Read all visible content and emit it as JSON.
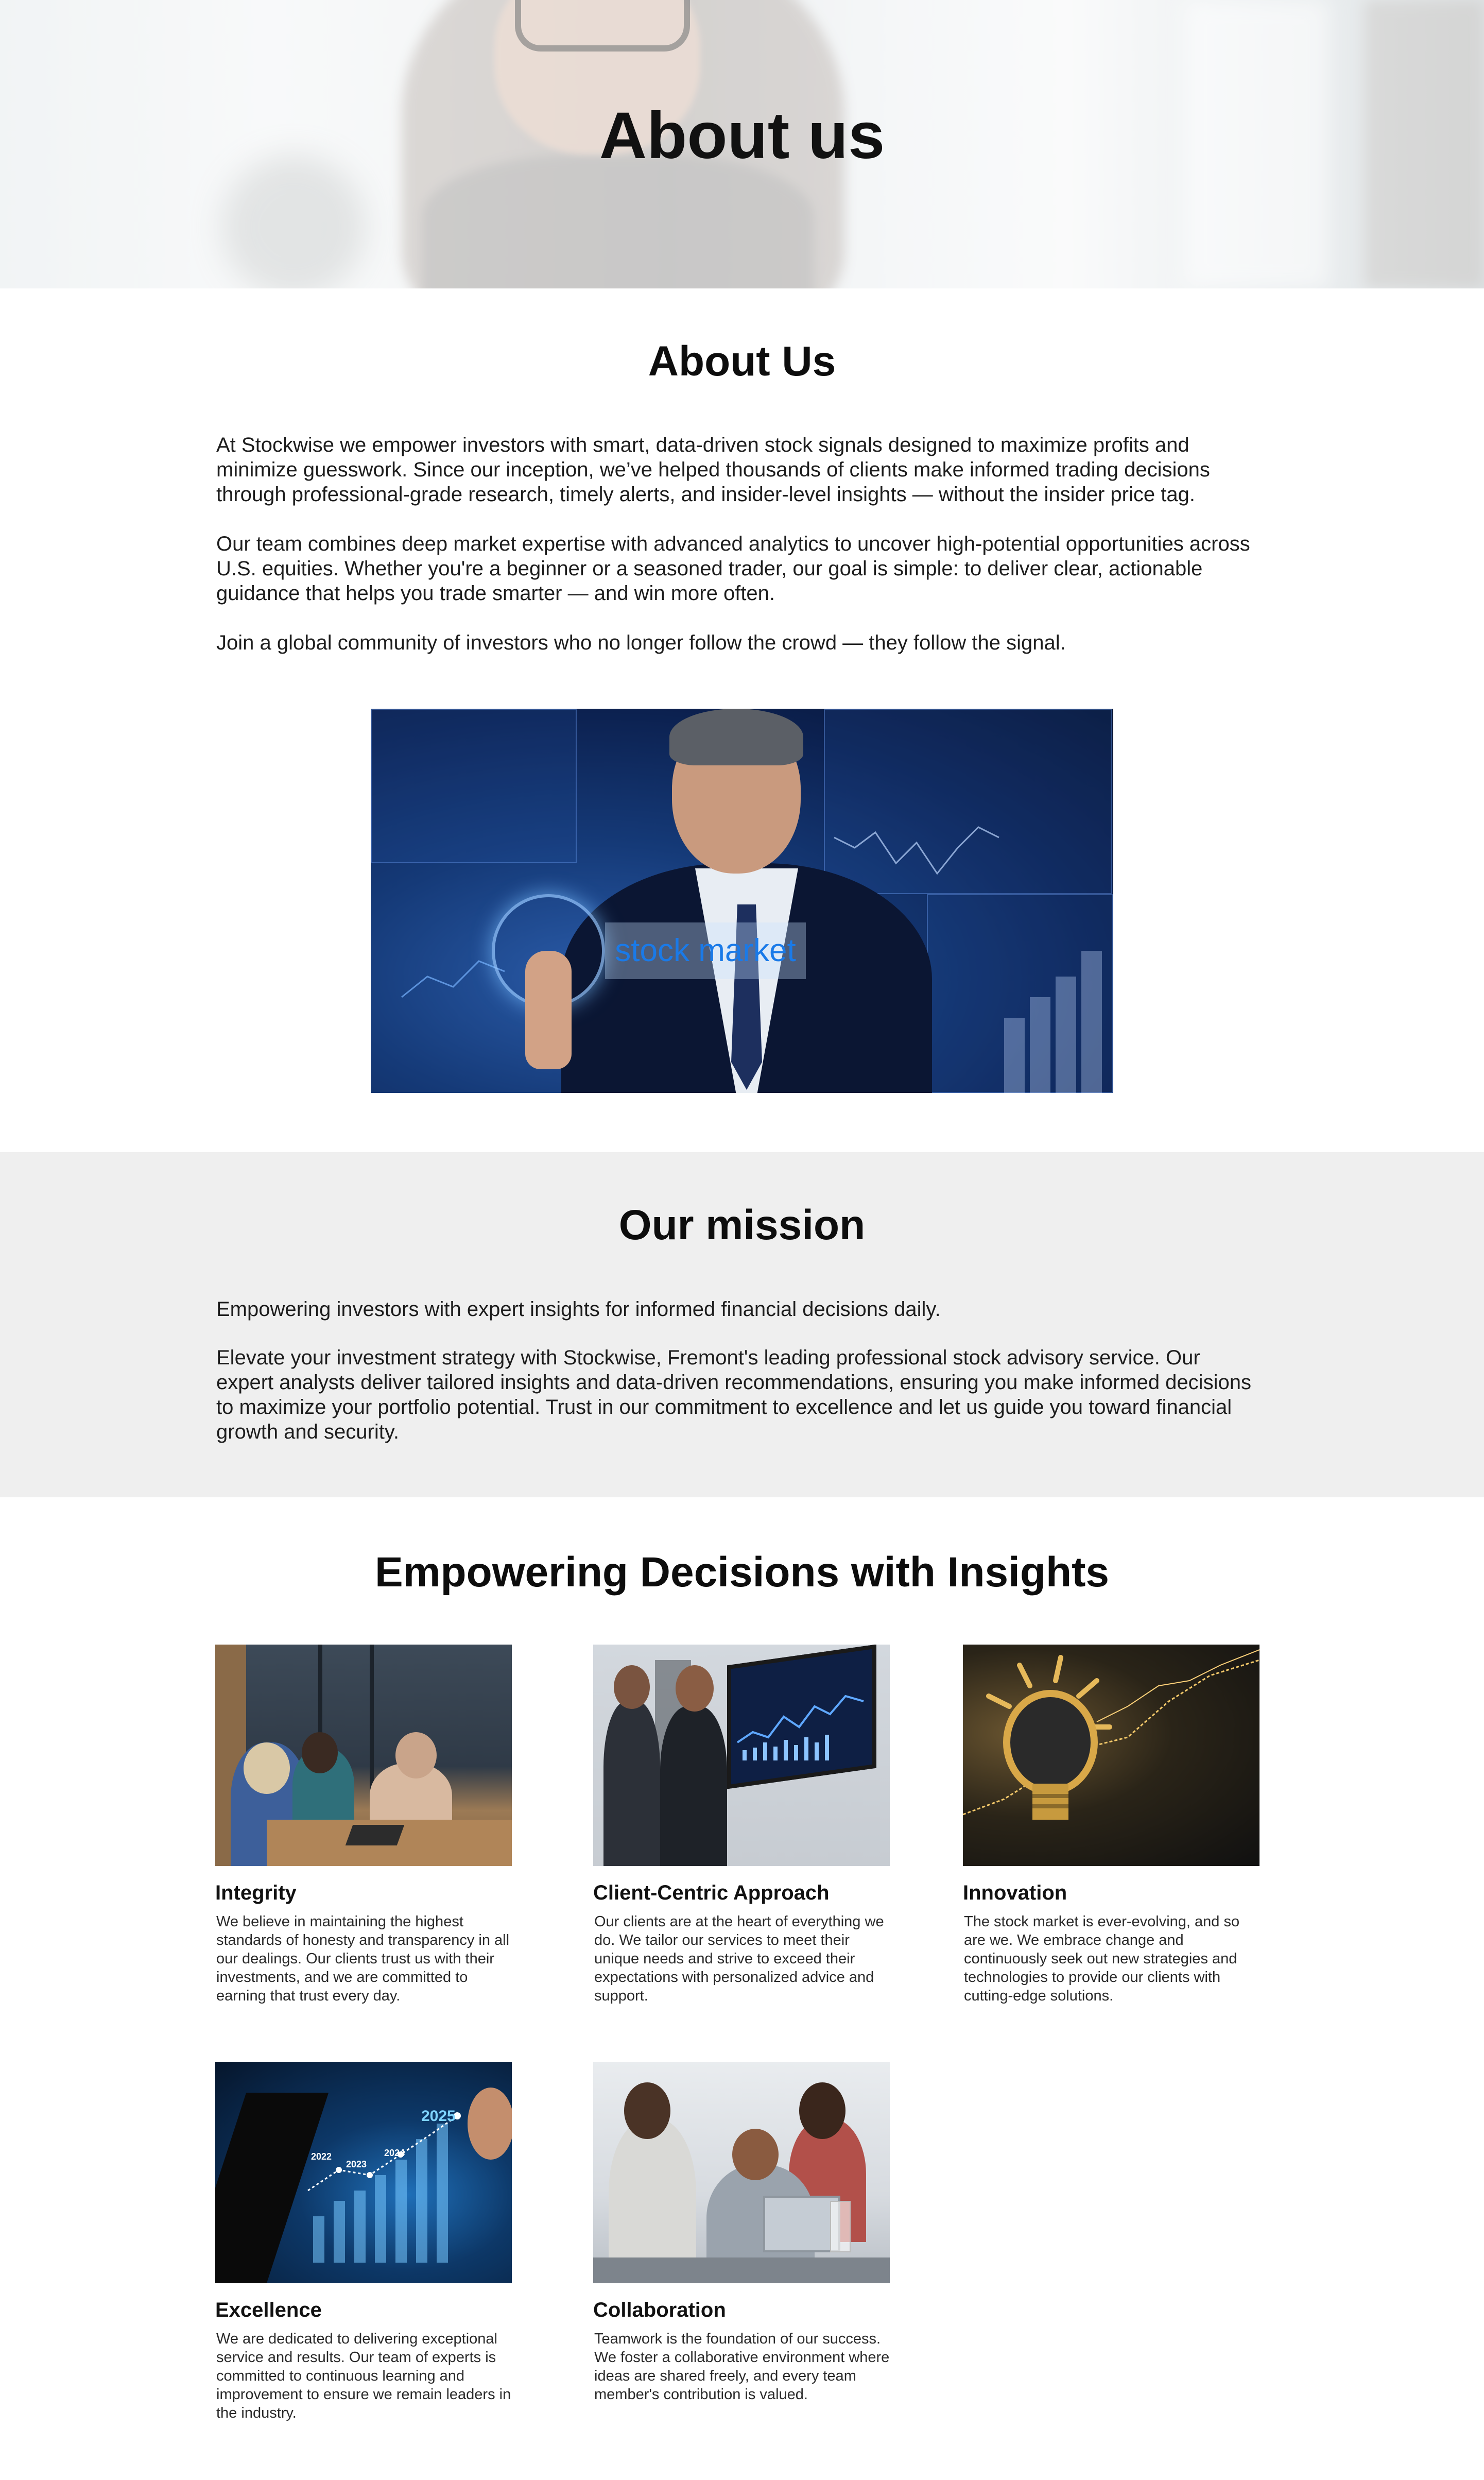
{
  "hero": {
    "title": "About us"
  },
  "about": {
    "title": "About Us",
    "paragraphs": [
      "At Stockwise we empower investors with smart, data-driven stock signals designed to maximize profits and minimize guesswork. Since our inception, we’ve helped thousands of clients make informed trading decisions through professional-grade research, timely alerts, and insider-level insights — without the insider price tag.",
      "Our team combines deep market expertise with advanced analytics to uncover high-potential opportunities across U.S. equities. Whether you're a beginner or a seasoned trader, our goal is simple: to deliver clear, actionable guidance that helps you trade smarter — and win more often.",
      "Join a global community of investors who no longer follow the crowd — they follow the signal."
    ],
    "image_label": "stock market"
  },
  "mission": {
    "title": "Our mission",
    "paragraphs": [
      "Empowering investors with expert insights for informed financial decisions daily.",
      "Elevate your investment strategy with Stockwise, Fremont's leading professional stock advisory service. Our expert analysts deliver tailored insights and data-driven recommendations, ensuring you make informed decisions to maximize your portfolio potential. Trust in our commitment to excellence and let us guide you toward financial growth and security."
    ]
  },
  "values": {
    "title": "Empowering Decisions with Insights",
    "cards": [
      {
        "title": "Integrity",
        "text": "We believe in maintaining the highest standards of honesty and transparency in all our dealings. Our clients trust us with their investments, and we are committed to earning that trust every day."
      },
      {
        "title": "Client-Centric Approach",
        "text": "Our clients are at the heart of everything we do. We tailor our services to meet their unique needs and strive to exceed their expectations with personalized advice and support."
      },
      {
        "title": "Innovation",
        "text": "The stock market is ever-evolving, and so are we. We embrace change and continuously seek out new strategies and technologies to provide our clients with cutting-edge solutions."
      },
      {
        "title": "Excellence",
        "text": "We are dedicated to delivering exceptional service and results. Our team of experts is committed to continuous learning and improvement to ensure we remain leaders in the industry."
      },
      {
        "title": "Collaboration",
        "text": "Teamwork is the foundation of our success. We foster a collaborative environment where ideas are shared freely, and every team member's contribution is valued."
      }
    ],
    "chart_years": [
      "2022",
      "2023",
      "2024",
      "2025"
    ]
  }
}
